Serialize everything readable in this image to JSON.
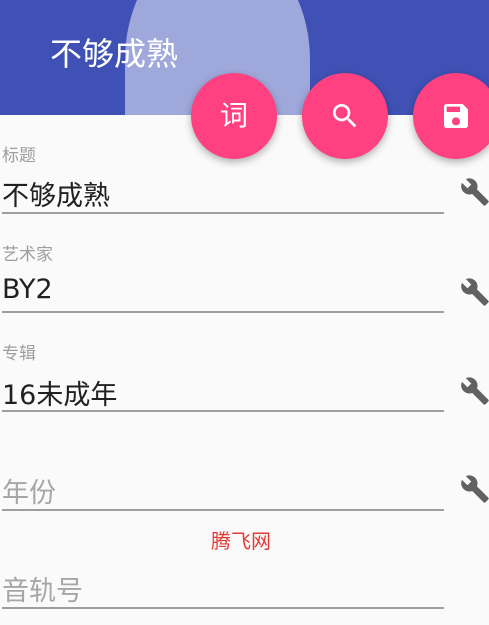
{
  "app_bar": {
    "title": "不够成熟",
    "colors": {
      "primary": "#3f51b5",
      "primary_light": "#9fa8da",
      "accent": "#ff4081"
    }
  },
  "fabs": [
    {
      "label": "词",
      "icon": "lyrics-text-icon"
    },
    {
      "label": "",
      "icon": "search-icon"
    },
    {
      "label": "",
      "icon": "save-icon"
    }
  ],
  "fields": {
    "title": {
      "label": "标题",
      "value": "不够成熟",
      "icon": "wrench-icon"
    },
    "artist": {
      "label": "艺术家",
      "value": "BY2",
      "icon": "wrench-icon"
    },
    "album": {
      "label": "专辑",
      "value": "16未成年",
      "icon": "wrench-icon"
    },
    "year": {
      "placeholder": "年份",
      "value": "",
      "icon": "wrench-icon"
    },
    "track": {
      "placeholder": "音轨号",
      "value": ""
    }
  },
  "watermark": "腾飞网"
}
